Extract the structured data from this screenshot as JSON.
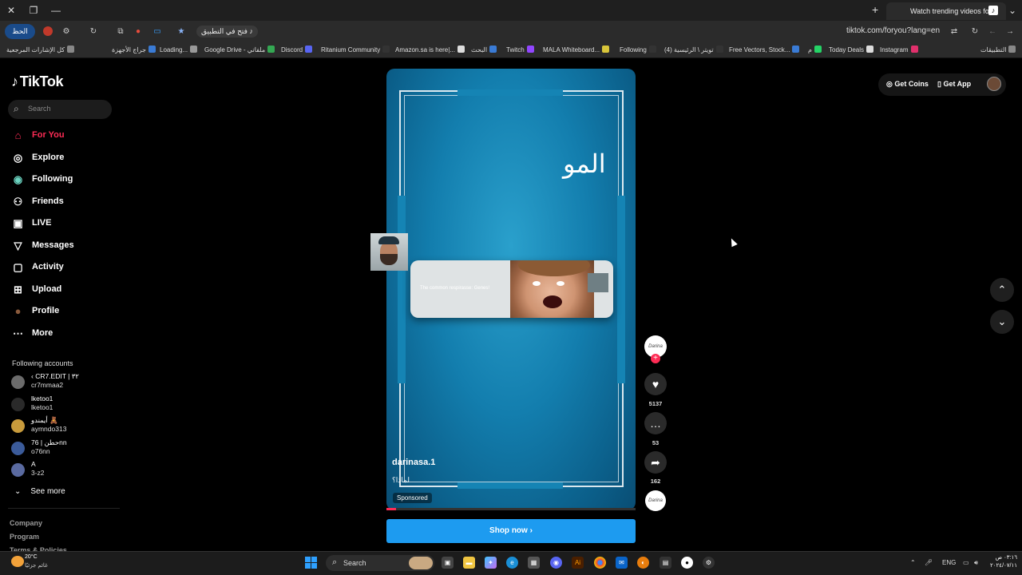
{
  "browser": {
    "tab_title": "Watch trending videos for y",
    "url": "tiktok.com/foryou?lang=en",
    "ai_button": "الحظ",
    "omnibox_app_chip": "فتح في التطبيق",
    "bookmarks": [
      "كل الإشارات المرجعية",
      "جراج الأجهزة",
      "Loading...",
      "Google Drive - ملفاتي",
      "Discord",
      "Ritanium Community",
      "Amazon.sa is here|...",
      "البحث",
      "Twitch",
      "MALA Whiteboard...",
      "Following",
      "(4) تويتر \\ الرئيسية",
      "Free Vectors, Stock...",
      "م",
      "Today Deals",
      "Instagram",
      "التطبيقات"
    ]
  },
  "sidebar": {
    "logo": "TikTok",
    "search_placeholder": "Search",
    "nav": [
      {
        "label": "For You",
        "icon": "home-icon",
        "active": true
      },
      {
        "label": "Explore",
        "icon": "compass-icon"
      },
      {
        "label": "Following",
        "icon": "following-icon"
      },
      {
        "label": "Friends",
        "icon": "friends-icon"
      },
      {
        "label": "LIVE",
        "icon": "live-icon"
      },
      {
        "label": "Messages",
        "icon": "messages-icon"
      },
      {
        "label": "Activity",
        "icon": "activity-icon"
      },
      {
        "label": "Upload",
        "icon": "upload-icon"
      },
      {
        "label": "Profile",
        "icon": "profile-icon"
      },
      {
        "label": "More",
        "icon": "more-icon"
      }
    ],
    "following_header": "Following accounts",
    "following": [
      {
        "name": "‹ CR7.EDIT | ٣٢",
        "handle": "cr7mmaa2"
      },
      {
        "name": "lketoo1",
        "handle": "lketoo1"
      },
      {
        "name": "أيمندو 🧸",
        "handle": "aymndo313"
      },
      {
        "name": "76 | حطنnn",
        "handle": "o76nn"
      },
      {
        "name": "A",
        "handle": "3-z2"
      }
    ],
    "see_more": "See more",
    "footer": [
      "Company",
      "Program",
      "Terms & Policies"
    ]
  },
  "header_right": {
    "get_coins": "Get Coins",
    "get_app": "Get App"
  },
  "video": {
    "overlay_text": "المو",
    "popup_caption": "The common respirasse: Genes!",
    "username": "darinasa.1",
    "description": "لماذا؟",
    "sponsored": "Sponsored",
    "progress": 0.04,
    "shop_button": "Shop now"
  },
  "actions": {
    "avatar_text": "Darina",
    "likes": "5137",
    "comments": "53",
    "shares": "162",
    "disc_text": "Darina"
  },
  "taskbar": {
    "weather_temp": "20°C",
    "weather_desc": "غائم جزئيًا",
    "search": "Search",
    "lang": "ENG",
    "time": "٠٣:١٦ ص",
    "date": "٢٠٢٤/٠٧/١١"
  },
  "colors": {
    "accent": "#fe2c55",
    "shop_button": "#1d9bf0",
    "video_bg": "#137eae"
  }
}
